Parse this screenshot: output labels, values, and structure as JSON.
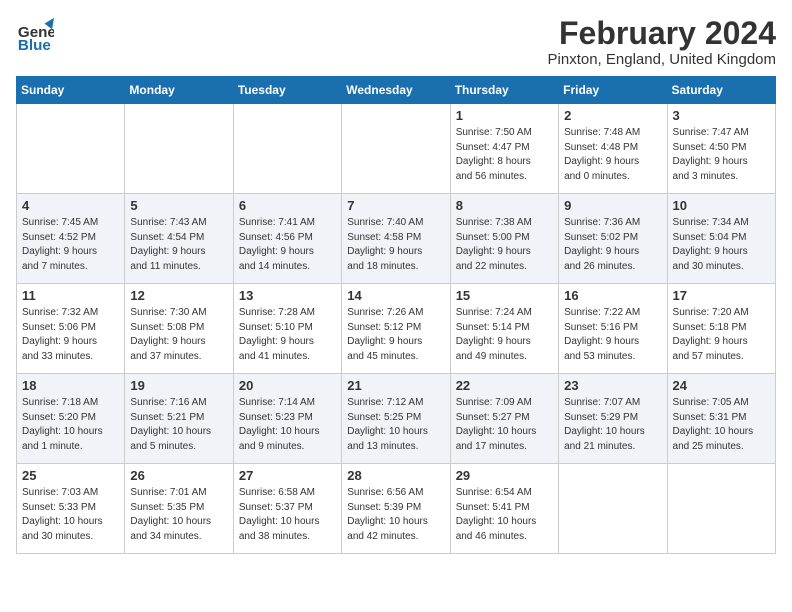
{
  "header": {
    "month": "February 2024",
    "location": "Pinxton, England, United Kingdom",
    "logo_general": "General",
    "logo_blue": "Blue"
  },
  "weekdays": [
    "Sunday",
    "Monday",
    "Tuesday",
    "Wednesday",
    "Thursday",
    "Friday",
    "Saturday"
  ],
  "weeks": [
    [
      {
        "day": "",
        "info": ""
      },
      {
        "day": "",
        "info": ""
      },
      {
        "day": "",
        "info": ""
      },
      {
        "day": "",
        "info": ""
      },
      {
        "day": "1",
        "info": "Sunrise: 7:50 AM\nSunset: 4:47 PM\nDaylight: 8 hours\nand 56 minutes."
      },
      {
        "day": "2",
        "info": "Sunrise: 7:48 AM\nSunset: 4:48 PM\nDaylight: 9 hours\nand 0 minutes."
      },
      {
        "day": "3",
        "info": "Sunrise: 7:47 AM\nSunset: 4:50 PM\nDaylight: 9 hours\nand 3 minutes."
      }
    ],
    [
      {
        "day": "4",
        "info": "Sunrise: 7:45 AM\nSunset: 4:52 PM\nDaylight: 9 hours\nand 7 minutes."
      },
      {
        "day": "5",
        "info": "Sunrise: 7:43 AM\nSunset: 4:54 PM\nDaylight: 9 hours\nand 11 minutes."
      },
      {
        "day": "6",
        "info": "Sunrise: 7:41 AM\nSunset: 4:56 PM\nDaylight: 9 hours\nand 14 minutes."
      },
      {
        "day": "7",
        "info": "Sunrise: 7:40 AM\nSunset: 4:58 PM\nDaylight: 9 hours\nand 18 minutes."
      },
      {
        "day": "8",
        "info": "Sunrise: 7:38 AM\nSunset: 5:00 PM\nDaylight: 9 hours\nand 22 minutes."
      },
      {
        "day": "9",
        "info": "Sunrise: 7:36 AM\nSunset: 5:02 PM\nDaylight: 9 hours\nand 26 minutes."
      },
      {
        "day": "10",
        "info": "Sunrise: 7:34 AM\nSunset: 5:04 PM\nDaylight: 9 hours\nand 30 minutes."
      }
    ],
    [
      {
        "day": "11",
        "info": "Sunrise: 7:32 AM\nSunset: 5:06 PM\nDaylight: 9 hours\nand 33 minutes."
      },
      {
        "day": "12",
        "info": "Sunrise: 7:30 AM\nSunset: 5:08 PM\nDaylight: 9 hours\nand 37 minutes."
      },
      {
        "day": "13",
        "info": "Sunrise: 7:28 AM\nSunset: 5:10 PM\nDaylight: 9 hours\nand 41 minutes."
      },
      {
        "day": "14",
        "info": "Sunrise: 7:26 AM\nSunset: 5:12 PM\nDaylight: 9 hours\nand 45 minutes."
      },
      {
        "day": "15",
        "info": "Sunrise: 7:24 AM\nSunset: 5:14 PM\nDaylight: 9 hours\nand 49 minutes."
      },
      {
        "day": "16",
        "info": "Sunrise: 7:22 AM\nSunset: 5:16 PM\nDaylight: 9 hours\nand 53 minutes."
      },
      {
        "day": "17",
        "info": "Sunrise: 7:20 AM\nSunset: 5:18 PM\nDaylight: 9 hours\nand 57 minutes."
      }
    ],
    [
      {
        "day": "18",
        "info": "Sunrise: 7:18 AM\nSunset: 5:20 PM\nDaylight: 10 hours\nand 1 minute."
      },
      {
        "day": "19",
        "info": "Sunrise: 7:16 AM\nSunset: 5:21 PM\nDaylight: 10 hours\nand 5 minutes."
      },
      {
        "day": "20",
        "info": "Sunrise: 7:14 AM\nSunset: 5:23 PM\nDaylight: 10 hours\nand 9 minutes."
      },
      {
        "day": "21",
        "info": "Sunrise: 7:12 AM\nSunset: 5:25 PM\nDaylight: 10 hours\nand 13 minutes."
      },
      {
        "day": "22",
        "info": "Sunrise: 7:09 AM\nSunset: 5:27 PM\nDaylight: 10 hours\nand 17 minutes."
      },
      {
        "day": "23",
        "info": "Sunrise: 7:07 AM\nSunset: 5:29 PM\nDaylight: 10 hours\nand 21 minutes."
      },
      {
        "day": "24",
        "info": "Sunrise: 7:05 AM\nSunset: 5:31 PM\nDaylight: 10 hours\nand 25 minutes."
      }
    ],
    [
      {
        "day": "25",
        "info": "Sunrise: 7:03 AM\nSunset: 5:33 PM\nDaylight: 10 hours\nand 30 minutes."
      },
      {
        "day": "26",
        "info": "Sunrise: 7:01 AM\nSunset: 5:35 PM\nDaylight: 10 hours\nand 34 minutes."
      },
      {
        "day": "27",
        "info": "Sunrise: 6:58 AM\nSunset: 5:37 PM\nDaylight: 10 hours\nand 38 minutes."
      },
      {
        "day": "28",
        "info": "Sunrise: 6:56 AM\nSunset: 5:39 PM\nDaylight: 10 hours\nand 42 minutes."
      },
      {
        "day": "29",
        "info": "Sunrise: 6:54 AM\nSunset: 5:41 PM\nDaylight: 10 hours\nand 46 minutes."
      },
      {
        "day": "",
        "info": ""
      },
      {
        "day": "",
        "info": ""
      }
    ]
  ]
}
